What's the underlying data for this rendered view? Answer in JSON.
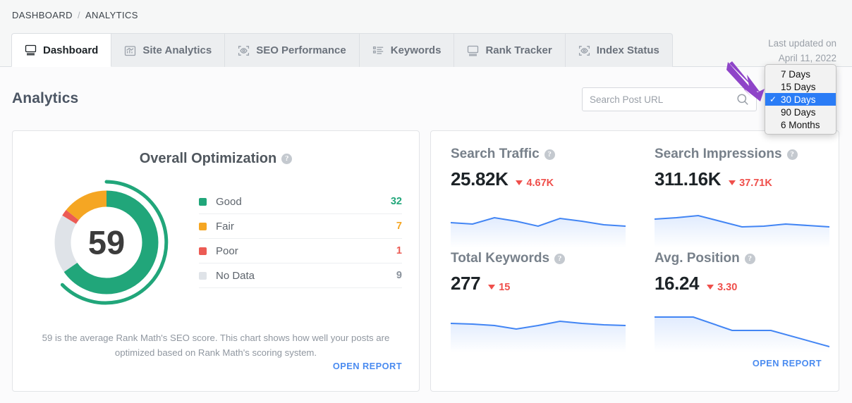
{
  "breadcrumb": {
    "root": "DASHBOARD",
    "separator": "/",
    "current": "ANALYTICS"
  },
  "tabs": [
    {
      "label": "Dashboard",
      "icon": "monitor-icon",
      "active": true
    },
    {
      "label": "Site Analytics",
      "icon": "bar-chart-icon",
      "active": false
    },
    {
      "label": "SEO Performance",
      "icon": "eye-scan-icon",
      "active": false
    },
    {
      "label": "Keywords",
      "icon": "list-icon",
      "active": false
    },
    {
      "label": "Rank Tracker",
      "icon": "monitor-icon",
      "active": false
    },
    {
      "label": "Index Status",
      "icon": "eye-scan-icon",
      "active": false
    }
  ],
  "last_updated": {
    "label": "Last updated on",
    "date": "April 11, 2022"
  },
  "page_title": "Analytics",
  "search": {
    "placeholder": "Search Post URL",
    "value": "",
    "icon": "search-icon"
  },
  "date_dropdown": {
    "selected": "30 Days",
    "check_glyph": "✓",
    "options": [
      "7 Days",
      "15 Days",
      "30 Days",
      "90 Days",
      "6 Months"
    ],
    "highlight_color": "#2a7cf6"
  },
  "optimization_card": {
    "title": "Overall Optimization",
    "help_glyph": "?",
    "score": "59",
    "description": "59 is the average Rank Math's SEO score. This chart shows how well your posts are optimized based on Rank Math's scoring system.",
    "open_report": "OPEN REPORT",
    "legend": [
      {
        "label": "Good",
        "value": "32",
        "color": "#21a67a"
      },
      {
        "label": "Fair",
        "value": "7",
        "color": "#f5a623"
      },
      {
        "label": "Poor",
        "value": "1",
        "color": "#ec5b54"
      },
      {
        "label": "No Data",
        "value": "9",
        "color": "#dfe3e8"
      }
    ]
  },
  "stats_card": {
    "open_report": "OPEN REPORT",
    "items": [
      {
        "title": "Search Traffic",
        "help_glyph": "?",
        "value": "25.82K",
        "delta": "4.67K",
        "trend": "down"
      },
      {
        "title": "Search Impressions",
        "help_glyph": "?",
        "value": "311.16K",
        "delta": "37.71K",
        "trend": "down"
      },
      {
        "title": "Total Keywords",
        "help_glyph": "?",
        "value": "277",
        "delta": "15",
        "trend": "down"
      },
      {
        "title": "Avg. Position",
        "help_glyph": "?",
        "value": "16.24",
        "delta": "3.30",
        "trend": "down"
      }
    ]
  },
  "chart_data": [
    {
      "type": "pie",
      "title": "Overall Optimization",
      "labels": [
        "Good",
        "Fair",
        "Poor",
        "No Data"
      ],
      "values": [
        32,
        7,
        1,
        9
      ],
      "colors": [
        "#21a67a",
        "#f5a623",
        "#ec5b54",
        "#dfe3e8"
      ],
      "center_label": "59",
      "outer_gauge_percent": 59,
      "outer_gauge_color": "#21a67a",
      "legend": "right"
    },
    {
      "type": "area",
      "title": "Search Traffic",
      "values": [
        62,
        60,
        46,
        55,
        70,
        64,
        48,
        40,
        52
      ],
      "ylabel": "",
      "xlabel": "",
      "line_color": "#4285f4",
      "grid": false
    },
    {
      "type": "area",
      "title": "Search Impressions",
      "values": [
        66,
        70,
        50,
        40,
        42,
        50,
        48,
        44,
        42
      ],
      "ylabel": "",
      "xlabel": "",
      "line_color": "#4285f4",
      "grid": false
    },
    {
      "type": "area",
      "title": "Total Keywords",
      "values": [
        60,
        58,
        52,
        44,
        52,
        64,
        58,
        55,
        52
      ],
      "ylabel": "",
      "xlabel": "",
      "line_color": "#4285f4",
      "grid": false
    },
    {
      "type": "area",
      "title": "Avg. Position",
      "values": [
        78,
        78,
        54,
        52,
        52,
        30,
        14
      ],
      "ylabel": "",
      "xlabel": "",
      "line_color": "#4285f4",
      "grid": false
    }
  ]
}
